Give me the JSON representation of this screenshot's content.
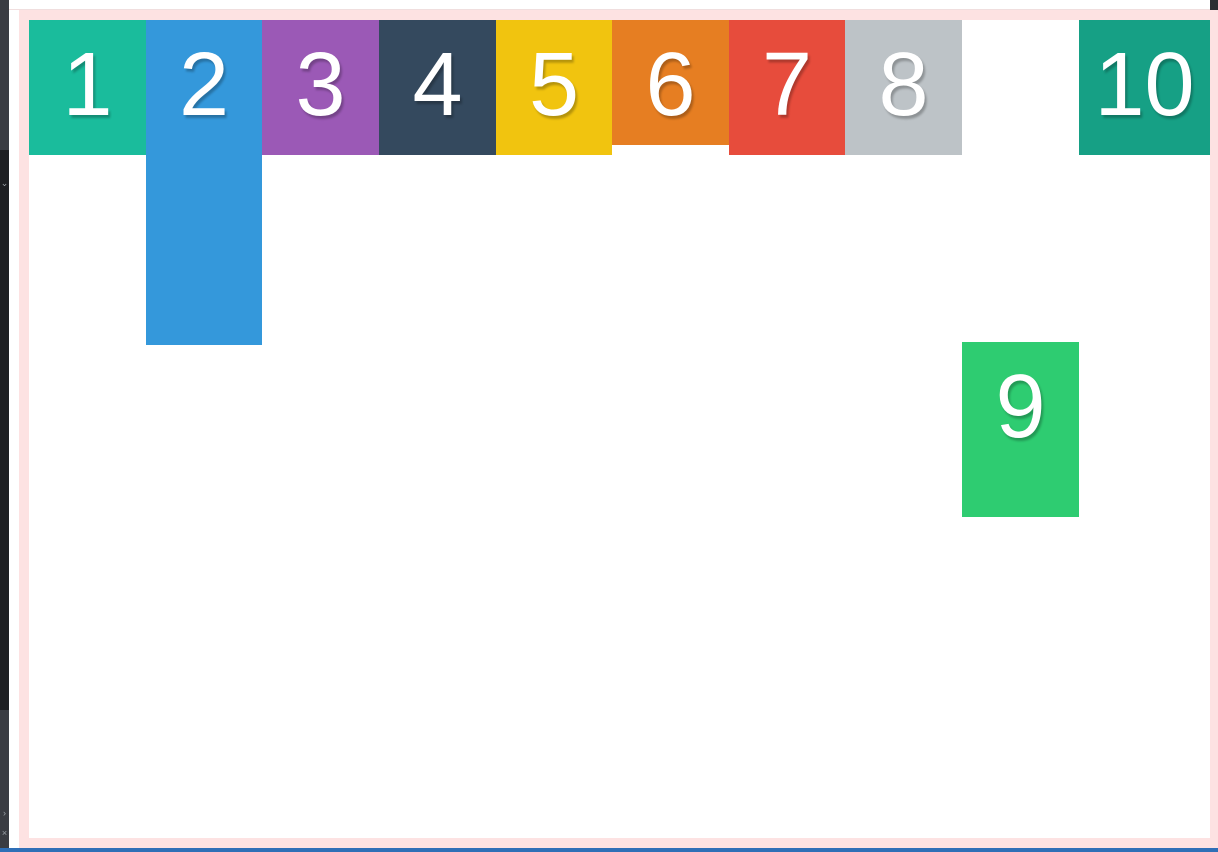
{
  "boxes": [
    {
      "label": "1",
      "color": "#1abc9c"
    },
    {
      "label": "2",
      "color": "#3498db"
    },
    {
      "label": "3",
      "color": "#9b59b6"
    },
    {
      "label": "4",
      "color": "#34495e"
    },
    {
      "label": "5",
      "color": "#f1c40f"
    },
    {
      "label": "6",
      "color": "#e67e22"
    },
    {
      "label": "7",
      "color": "#e74c3c"
    },
    {
      "label": "8",
      "color": "#bdc3c7"
    },
    {
      "label": "9",
      "color": "#2ecc71"
    },
    {
      "label": "10",
      "color": "#16a085"
    }
  ]
}
